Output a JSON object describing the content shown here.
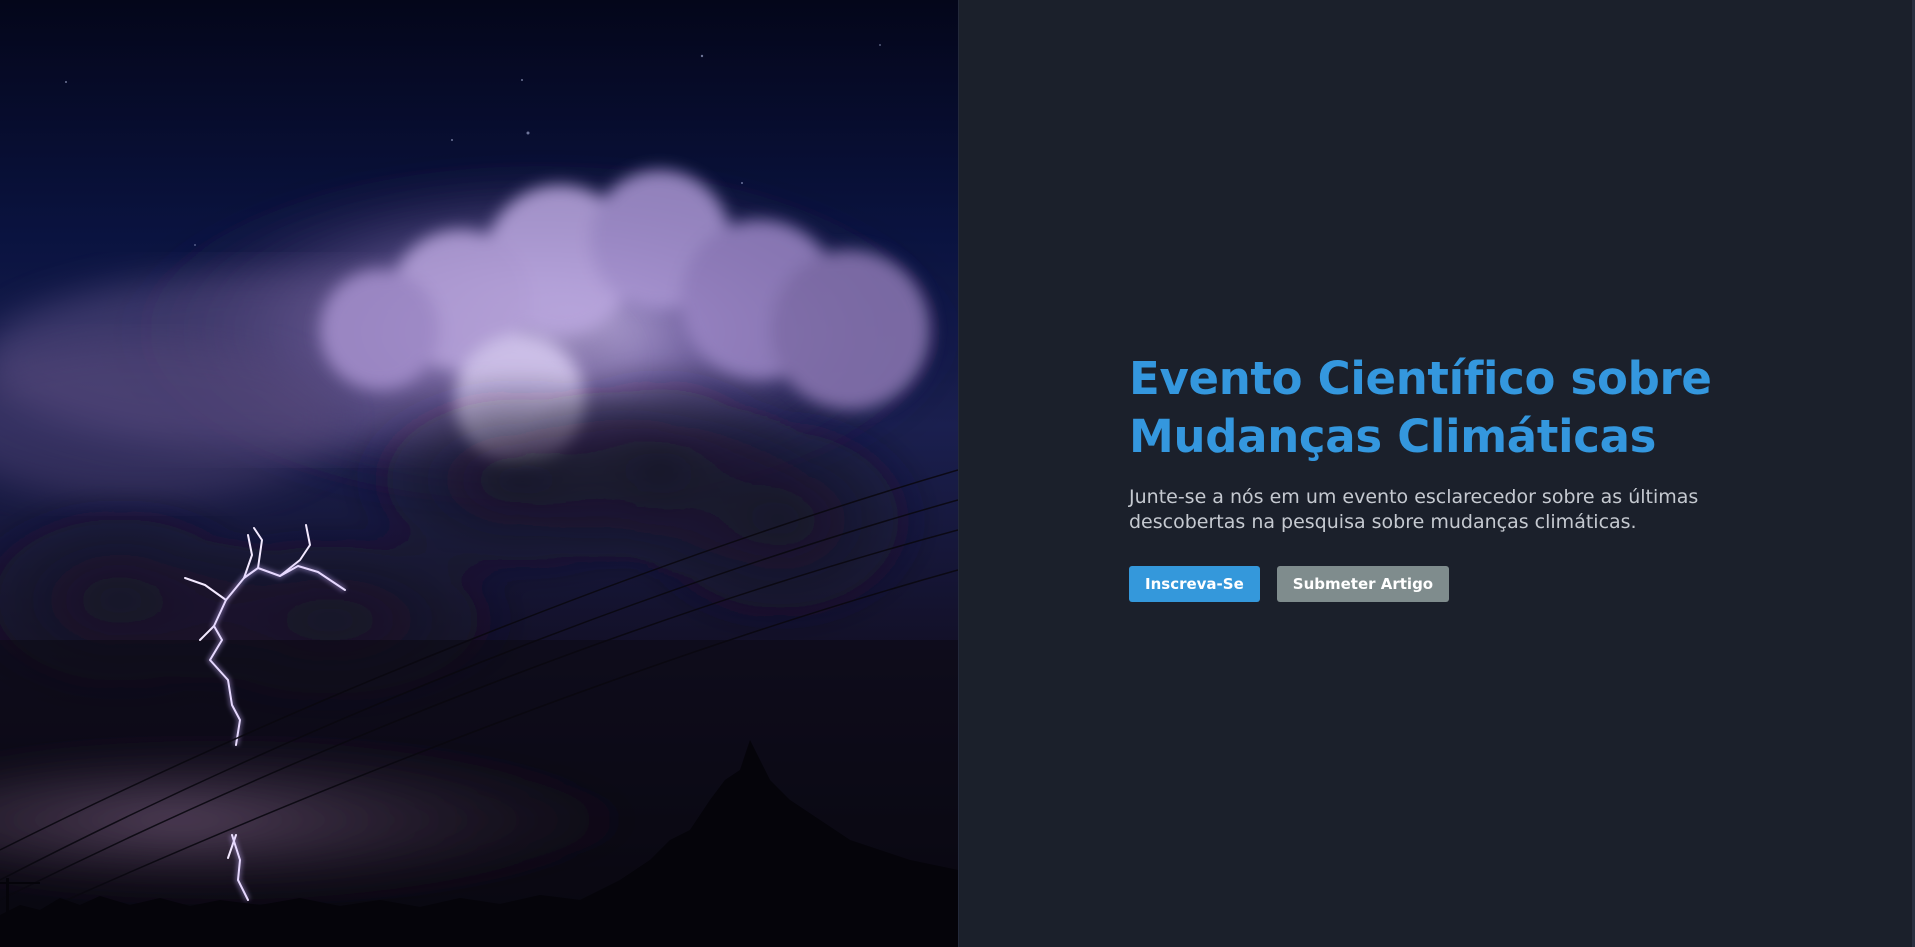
{
  "hero": {
    "image_alt": "Tempestade noturna com relâmpagos sobre nuvens"
  },
  "colors": {
    "accent": "#3498db",
    "secondary": "#7f8c8d",
    "panel_background": "#1b202b",
    "subtitle_text": "#c5c9d0"
  },
  "main": {
    "title": "Evento Científico sobre Mudanças Climáticas",
    "subtitle": "Junte-se a nós em um evento esclarecedor sobre as últimas descobertas na pesquisa sobre mudanças climáticas.",
    "buttons": {
      "register_label": "Inscreva-Se",
      "submit_label": "Submeter Artigo"
    }
  }
}
